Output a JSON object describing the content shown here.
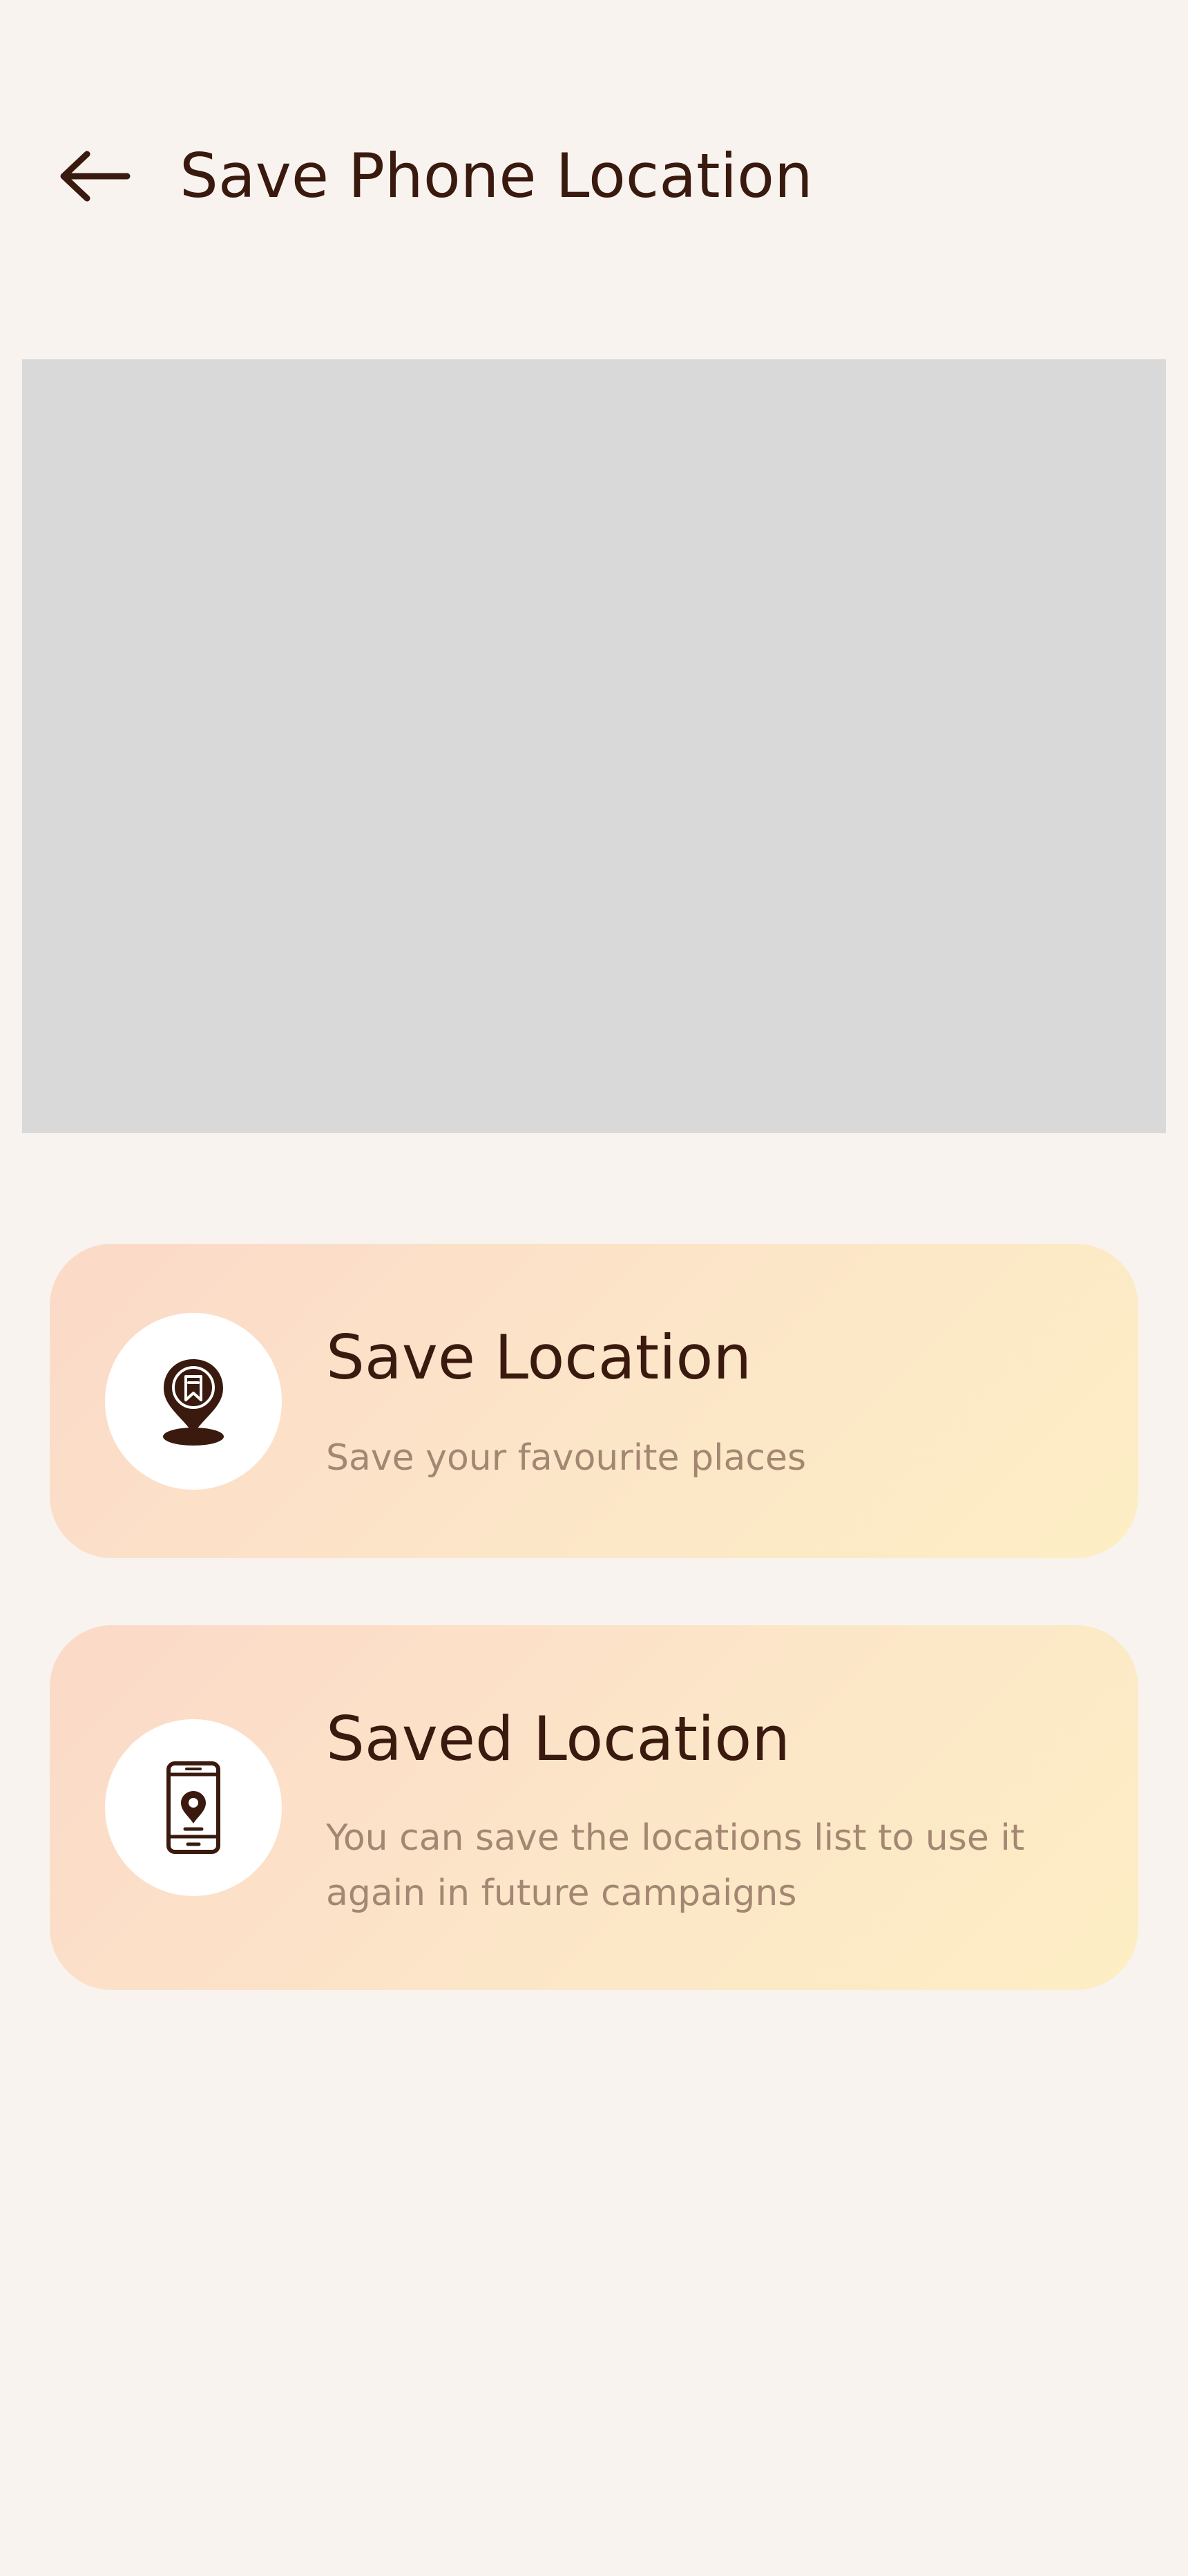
{
  "header": {
    "title": "Save Phone Location",
    "back_icon": "arrow-left-icon"
  },
  "map": {
    "placeholder_color": "#d9d9d9"
  },
  "cards": [
    {
      "title": "Save Location",
      "subtitle": "Save your favourite places",
      "icon": "location-pin-bookmark-icon"
    },
    {
      "title": "Saved Location",
      "subtitle": "You can save the locations list to use it again in future campaigns",
      "icon": "phone-location-icon"
    }
  ],
  "colors": {
    "background": "#f8f3ef",
    "text_primary": "#3a1a0e",
    "text_secondary": "#a38772",
    "card_gradient_start": "#fbd9c8",
    "card_gradient_end": "#fdeec4"
  }
}
